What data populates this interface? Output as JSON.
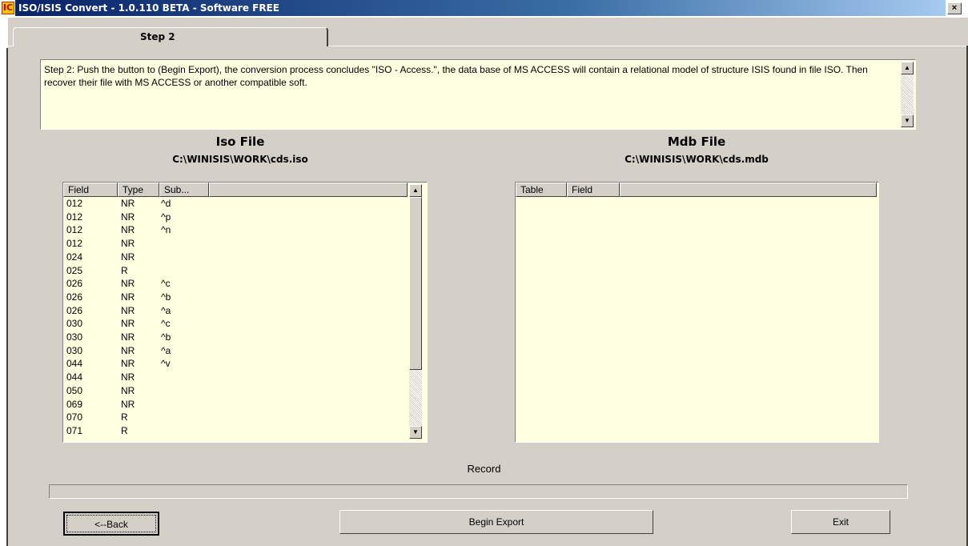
{
  "window": {
    "icon_letters": "IC",
    "title": "ISO/ISIS Convert - 1.0.110 BETA - Software FREE",
    "close_label": "×"
  },
  "tab": {
    "label": "Step 2"
  },
  "description": "Step 2: Push the button to (Begin Export), the conversion process concludes \"ISO - Access.\", the data base of MS ACCESS will contain a relational model of structure ISIS found in file ISO.    Then recover their file with MS ACCESS or another compatible soft.",
  "scroll": {
    "up": "▲",
    "down": "▼"
  },
  "iso": {
    "heading": "Iso File",
    "path": "C:\\WINISIS\\WORK\\cds.iso",
    "columns": [
      "Field",
      "Type",
      "Sub..."
    ],
    "rows": [
      [
        "012",
        "NR",
        "^d"
      ],
      [
        "012",
        "NR",
        "^p"
      ],
      [
        "012",
        "NR",
        "^n"
      ],
      [
        "012",
        "NR",
        ""
      ],
      [
        "024",
        "NR",
        ""
      ],
      [
        "025",
        "R",
        ""
      ],
      [
        "026",
        "NR",
        "^c"
      ],
      [
        "026",
        "NR",
        "^b"
      ],
      [
        "026",
        "NR",
        "^a"
      ],
      [
        "030",
        "NR",
        "^c"
      ],
      [
        "030",
        "NR",
        "^b"
      ],
      [
        "030",
        "NR",
        "^a"
      ],
      [
        "044",
        "NR",
        "^v"
      ],
      [
        "044",
        "NR",
        ""
      ],
      [
        "050",
        "NR",
        ""
      ],
      [
        "069",
        "NR",
        ""
      ],
      [
        "070",
        "R",
        ""
      ],
      [
        "071",
        "R",
        ""
      ]
    ]
  },
  "mdb": {
    "heading": "Mdb File",
    "path": "C:\\WINISIS\\WORK\\cds.mdb",
    "columns": [
      "Table",
      "Field"
    ]
  },
  "record_label": "Record",
  "progress": 0,
  "buttons": {
    "back": "<--Back",
    "begin_export": "Begin Export",
    "exit": "Exit"
  }
}
